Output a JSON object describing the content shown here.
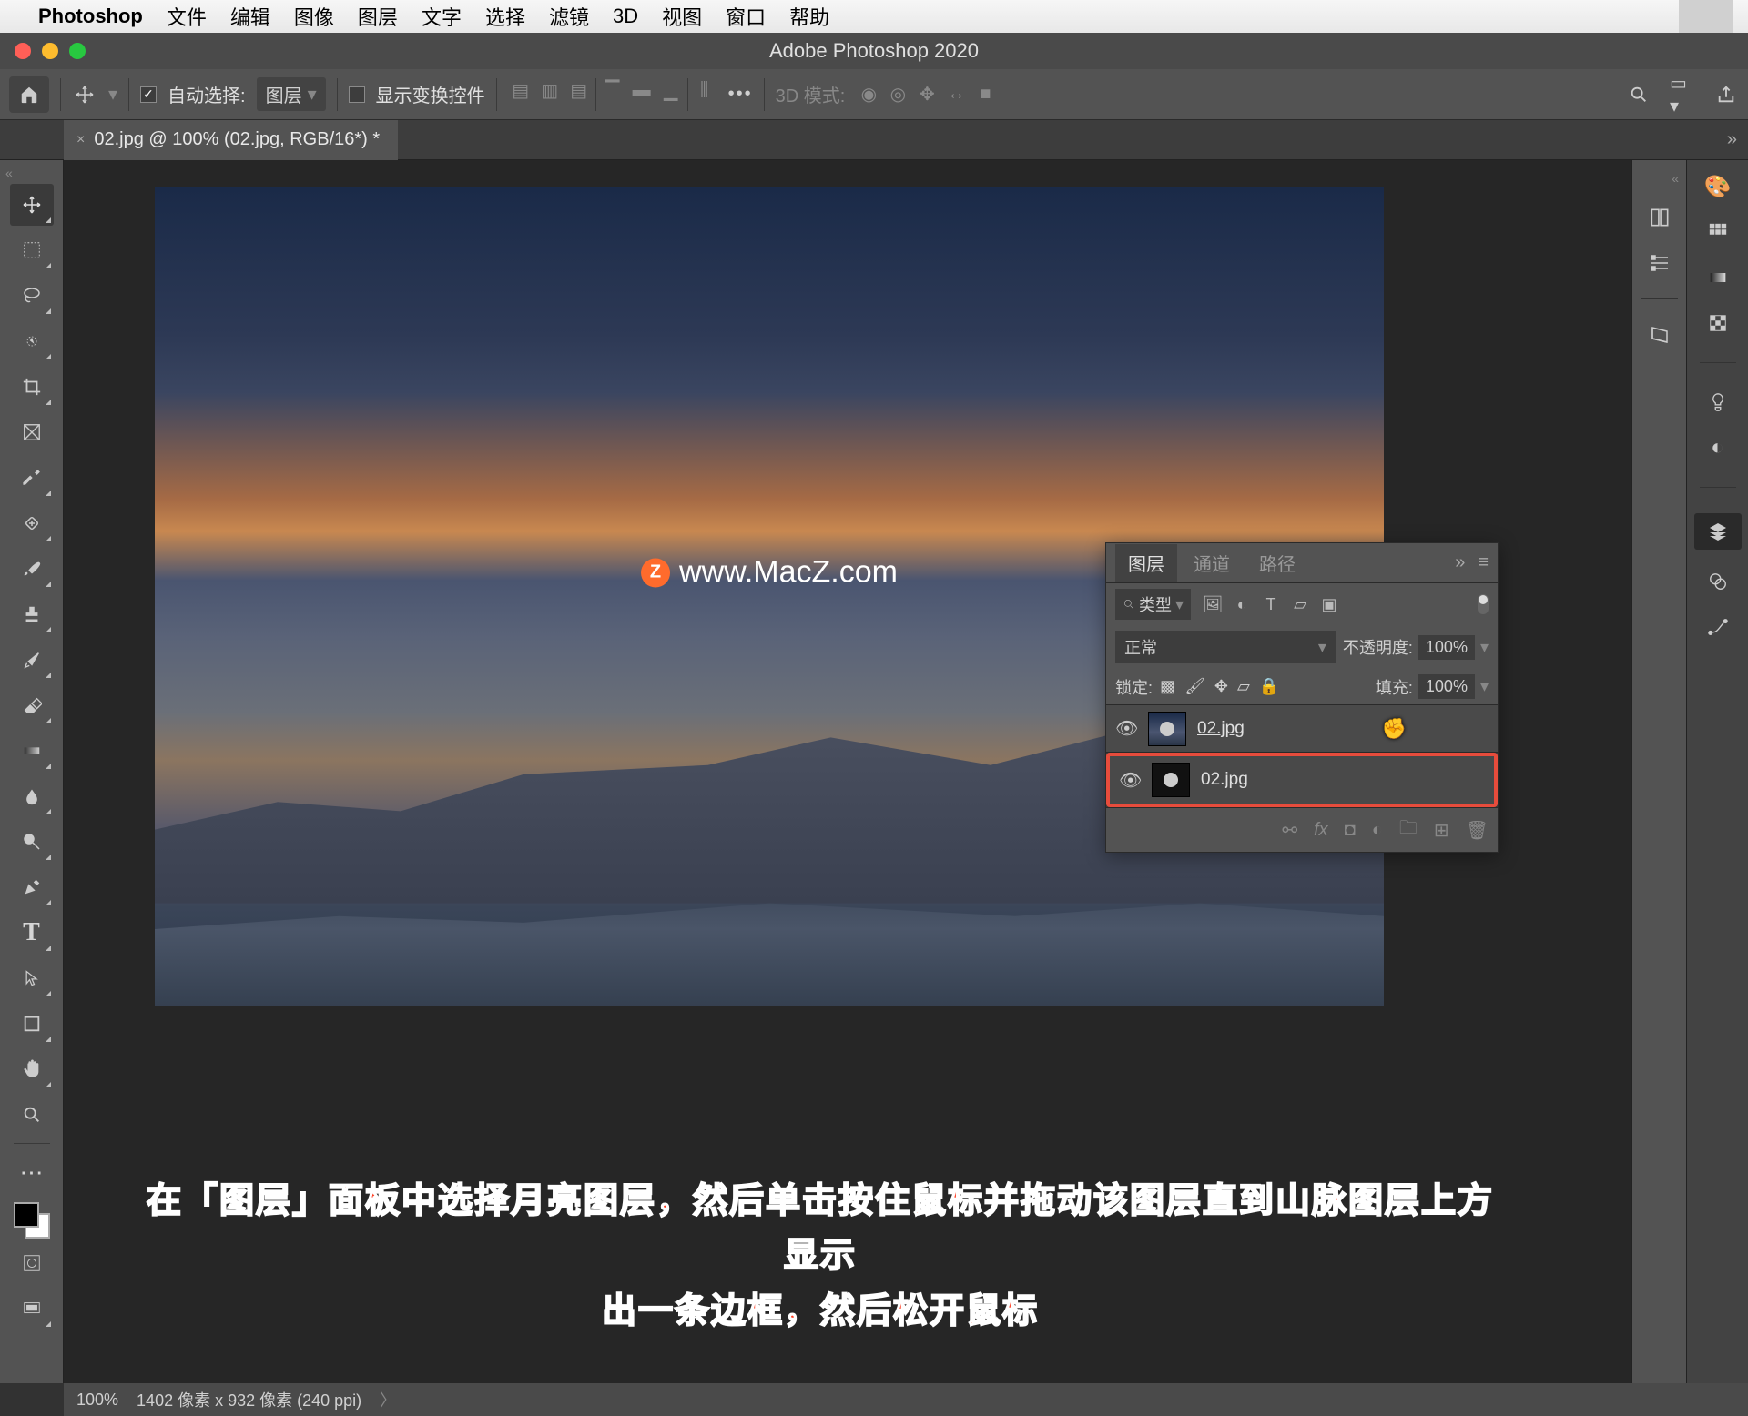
{
  "mac_menubar": {
    "app_name": "Photoshop",
    "menus": [
      "文件",
      "编辑",
      "图像",
      "图层",
      "文字",
      "选择",
      "滤镜",
      "3D",
      "视图",
      "窗口",
      "帮助"
    ]
  },
  "window": {
    "title": "Adobe Photoshop 2020"
  },
  "options_bar": {
    "auto_select_label": "自动选择:",
    "auto_select_value": "图层",
    "show_transform_label": "显示变换控件",
    "mode3d_label": "3D 模式:"
  },
  "doc_tab": {
    "close": "×",
    "title": "02.jpg @ 100% (02.jpg, RGB/16*) *"
  },
  "watermark": {
    "text": "www.MacZ.com"
  },
  "layers_panel": {
    "tabs": {
      "layers": "图层",
      "channels": "通道",
      "paths": "路径"
    },
    "kind_search": "类型",
    "blend_mode": "正常",
    "opacity_label": "不透明度:",
    "opacity_value": "100%",
    "lock_label": "锁定:",
    "fill_label": "填充:",
    "fill_value": "100%",
    "layers": [
      {
        "name": "02.jpg"
      },
      {
        "name": "02.jpg"
      }
    ]
  },
  "status_bar": {
    "zoom": "100%",
    "dims": "1402 像素 x 932 像素 (240 ppi)"
  },
  "instruction": {
    "line1": "在「图层」面板中选择月亮图层，然后单击按住鼠标并拖动该图层直到山脉图层上方显示",
    "line2": "出一条边框，然后松开鼠标"
  }
}
